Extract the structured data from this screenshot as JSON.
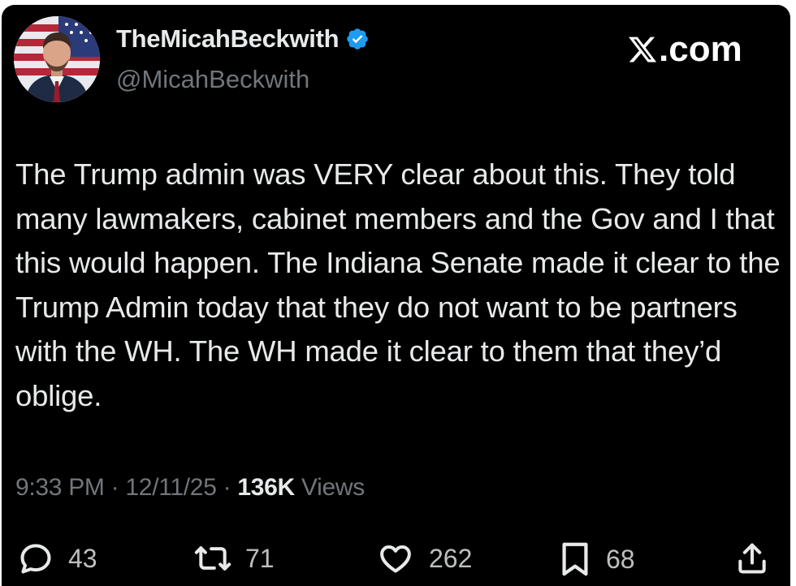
{
  "user": {
    "display_name": "TheMicahBeckwith",
    "handle": "@MicahBeckwith",
    "verified": true,
    "verified_color": "#1d9bf0"
  },
  "brand": {
    "label": ".com",
    "icon": "x-logo-icon"
  },
  "tweet": {
    "text": "The Trump admin was VERY clear about this. They told many lawmakers, cabinet members and the Gov and I that this would happen. The Indiana Senate made it clear to the Trump Admin today that they do not want to be partners with the WH. The WH made it clear to them that they’d oblige."
  },
  "meta": {
    "time": "9:33 PM",
    "separator": "·",
    "date": "12/11/25",
    "views_count": "136K",
    "views_label": "Views"
  },
  "actions": {
    "replies": {
      "icon": "reply-icon",
      "count": "43"
    },
    "reposts": {
      "icon": "repost-icon",
      "count": "71"
    },
    "likes": {
      "icon": "heart-icon",
      "count": "262"
    },
    "bookmarks": {
      "icon": "bookmark-icon",
      "count": "68"
    },
    "share": {
      "icon": "share-icon"
    }
  },
  "colors": {
    "background": "#000000",
    "text": "#e7e9ea",
    "secondary_text": "#71767b"
  }
}
